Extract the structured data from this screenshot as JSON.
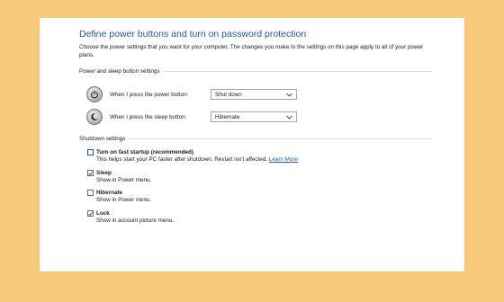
{
  "title": "Define power buttons and turn on password protection",
  "description": "Choose the power settings that you want for your computer. The changes you make to the settings on this page apply to all of your power plans.",
  "power_section": {
    "label": "Power and sleep button settings",
    "rows": [
      {
        "label": "When I press the power button:",
        "value": "Shut down",
        "icon": "power-icon"
      },
      {
        "label": "When I press the sleep button:",
        "value": "Hibernate",
        "icon": "sleep-moon-icon"
      }
    ]
  },
  "shutdown_section": {
    "label": "Shutdown settings",
    "options": [
      {
        "name": "Turn on fast startup (recommended)",
        "desc": "This helps start your PC faster after shutdown. Restart isn't affected.",
        "link": "Learn More",
        "checked": false
      },
      {
        "name": "Sleep",
        "desc": "Show in Power menu.",
        "checked": true
      },
      {
        "name": "Hibernate",
        "desc": "Show in Power menu.",
        "checked": false
      },
      {
        "name": "Lock",
        "desc": "Show in account picture menu.",
        "checked": true
      }
    ]
  },
  "colors": {
    "background": "#f7c97a",
    "panel": "#ffffff",
    "title": "#1e5aa8",
    "link": "#1e5aa8"
  }
}
